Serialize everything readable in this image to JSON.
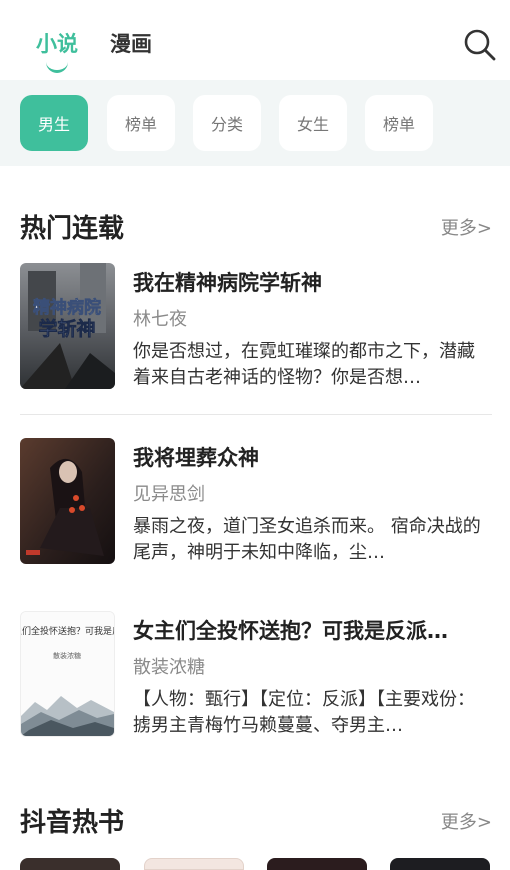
{
  "header": {
    "tabs": [
      {
        "label": "小说",
        "active": true
      },
      {
        "label": "漫画",
        "active": false
      }
    ],
    "search_icon": "search-icon"
  },
  "category_tabs": [
    {
      "label": "男生",
      "active": true
    },
    {
      "label": "榜单",
      "active": false
    },
    {
      "label": "分类",
      "active": false
    },
    {
      "label": "女生",
      "active": false
    },
    {
      "label": "榜单",
      "active": false
    }
  ],
  "sections": {
    "hot": {
      "title": "热门连载",
      "more": "更多>",
      "books": [
        {
          "title": "我在精神病院学斩神",
          "author": "林七夜",
          "description": "你是否想过，在霓虹璀璨的都市之下，潜藏着来自古老神话的怪物？你是否想…",
          "cover_text": "我在精神病院学斩神"
        },
        {
          "title": "我将埋葬众神",
          "author": "见异思剑",
          "description": "暴雨之夜，道门圣女追杀而来。    宿命决战的尾声，神明于未知中降临，尘…"
        },
        {
          "title": "女主们全投怀送抱？可我是反派…",
          "author": "散装浓糖",
          "description": "【人物：甄行】【定位：反派】【主要戏份：掳男主青梅竹马赖蔓蔓、夺男主…",
          "cover_text": "女主们全投怀送抱？可我是反派",
          "cover_subtext": "散装浓糖"
        }
      ]
    },
    "douyin": {
      "title": "抖音热书",
      "more": "更多>"
    }
  },
  "colors": {
    "accent": "#3fbf9c",
    "strip_bg": "#f2f6f6"
  }
}
